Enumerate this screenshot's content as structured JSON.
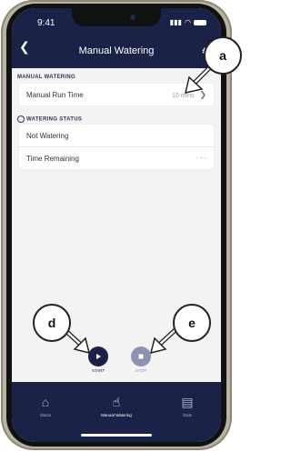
{
  "status_bar": {
    "time": "9:41"
  },
  "header": {
    "title": "Manual Watering"
  },
  "manual_watering": {
    "section_title": "MANUAL WATERING",
    "run_time_label": "Manual Run Time",
    "run_time_value": "10 mins"
  },
  "watering_status": {
    "section_title": "WATERING STATUS",
    "state_label": "Not Watering",
    "time_remaining_label": "Time Remaining",
    "time_remaining_value": "- - -"
  },
  "controls": {
    "start_label": "START",
    "stop_label": "STOP"
  },
  "tabs": [
    {
      "label": "Status",
      "icon": "home-icon"
    },
    {
      "label": "Manual Watering",
      "icon": "hand-tap-icon"
    },
    {
      "label": "Stats",
      "icon": "stats-icon"
    }
  ],
  "callouts": {
    "a": "a",
    "d": "d",
    "e": "e"
  },
  "colors": {
    "nav": "#1b2247",
    "button_active": "#1b2247",
    "button_inactive": "#8b93b4"
  }
}
